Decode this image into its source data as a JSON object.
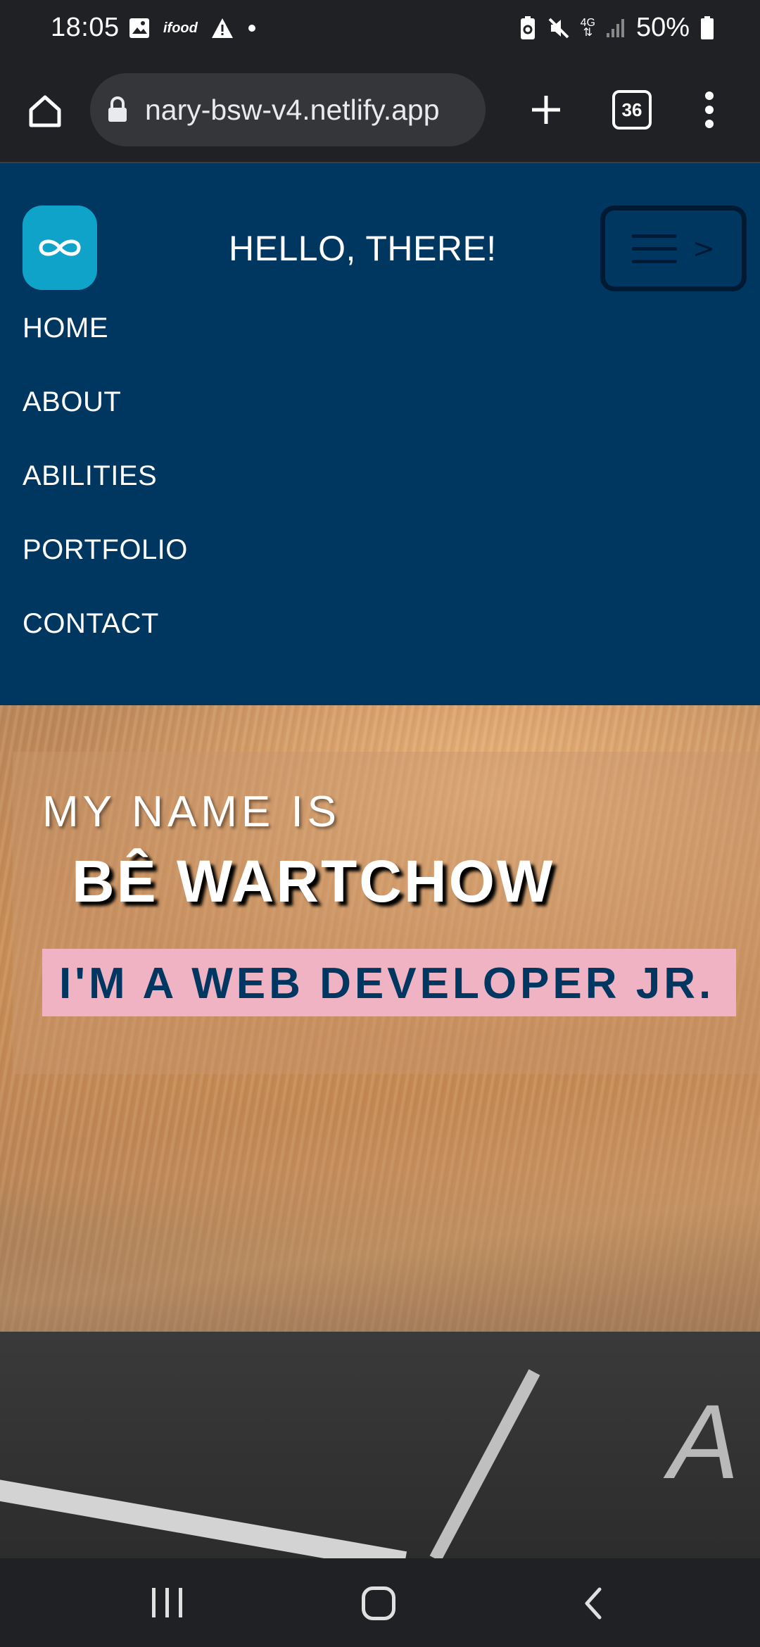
{
  "status_bar": {
    "time": "18:05",
    "left_icons": [
      "image-icon",
      "ifood-icon",
      "warning-icon",
      "dot-icon"
    ],
    "ifood_label": "ifood",
    "network_label": "4G",
    "battery_percent": "50%",
    "right_icons": [
      "battery-saver-icon",
      "mute-icon",
      "network-icon",
      "signal-icon",
      "battery-icon"
    ]
  },
  "browser": {
    "url": "https://binary-bsw-v4.netlify.app",
    "url_display": "nary-bsw-v4.netlify.app",
    "tab_count": "36"
  },
  "site": {
    "greeting": "HELLO, THERE!",
    "nav": [
      "HOME",
      "ABOUT",
      "ABILITIES",
      "PORTFOLIO",
      "CONTACT"
    ],
    "toggle_arrow": ">"
  },
  "hero": {
    "intro": "MY NAME IS",
    "name": "BÊ WARTCHOW",
    "role": "I'M A WEB DEVELOPER JR.",
    "keycap_letter": "A"
  },
  "colors": {
    "header_bg": "#003761",
    "logo_bg": "#0fa3c9",
    "role_band": "#efb3c4",
    "role_text": "#003761"
  }
}
